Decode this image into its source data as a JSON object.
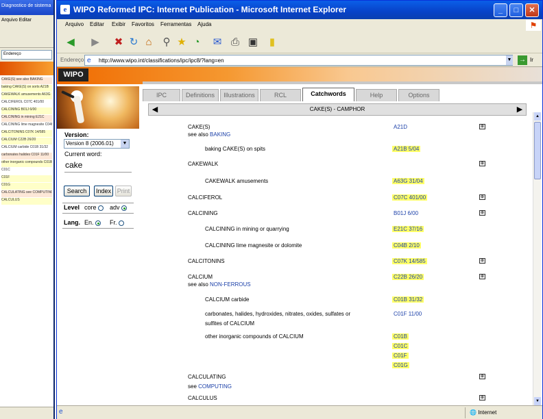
{
  "background_window": {
    "title": "Diagnostico de sistema",
    "menu": "Arquivo Editar",
    "address": "Endereço",
    "rows": [
      "CAKE(S) see also BAKING",
      "baking CAKE(S) on sorts A21B",
      "CAKEWALK amusements A63G",
      "CALCIFEROL C07C 401/00",
      "CALCINING B01J 6/00",
      "CALCINING in mining E21C",
      "CALCINING lime magnesite C04B",
      "CALCITONINS C07K 14/585",
      "CALCIUM C22B 26/20",
      "CALCIUM carbide C01B 31/32",
      "carbonates halides C01F 11/00",
      "other inorganic compounds C01B",
      "C01C",
      "C01F",
      "C01G",
      "CALCULATING see COMPUTING",
      "CALCULUS"
    ]
  },
  "window": {
    "title": "WIPO Reformed IPC: Internet Publication - Microsoft Internet Explorer",
    "minimize": "_",
    "maximize": "□",
    "close": "✕"
  },
  "menu": [
    "Arquivo",
    "Editar",
    "Exibir",
    "Favoritos",
    "Ferramentas",
    "Ajuda"
  ],
  "address": {
    "label": "Endereço",
    "url": "http://www.wipo.int/classifications/ipc/ipc8/?lang=en",
    "go": "Ir"
  },
  "page": {
    "logo": "WIPO",
    "version_label": "Version:",
    "version_value": "Version 8 (2006.01)",
    "current_word_label": "Current word:",
    "current_word": "cake",
    "search_btn": "Search",
    "index_btn": "Index",
    "print_btn": "Print",
    "level_label": "Level",
    "level_core": "core",
    "level_adv": "adv",
    "lang_label": "Lang.",
    "lang_en": "En.",
    "lang_fr": "Fr.",
    "tabs": [
      "IPC",
      "Definitions",
      "Illustrations",
      "RCL",
      "Catchwords",
      "Help",
      "Options"
    ],
    "nav_title": "CAKE(S) - CAMPHOR",
    "nav_prev": "◀",
    "nav_next": "▶"
  },
  "entries": [
    {
      "kw": "CAKE(S)",
      "code": "A21D",
      "hl": false,
      "ex": true
    },
    {
      "see": "see also",
      "link": "BAKING"
    },
    {
      "sub": "baking CAKE(S) on spits",
      "code": "A21B 5/04",
      "hl": true
    },
    {
      "kw": "CAKEWALK",
      "ex": true
    },
    {
      "sub": "CAKEWALK amusements",
      "code": "A63G 31/04",
      "hl": true
    },
    {
      "kw": "CALCIFEROL",
      "code": "C07C 401/00",
      "hl": true,
      "ex": true
    },
    {
      "kw": "CALCINING",
      "code": "B01J 6/00",
      "hl": false,
      "ex": true
    },
    {
      "sub": "CALCINING in mining or quarrying",
      "code": "E21C 37/16",
      "hl": true
    },
    {
      "sub": "CALCINING lime magnesite or dolomite",
      "code": "C04B 2/10",
      "hl": true
    },
    {
      "kw": "CALCITONINS",
      "code": "C07K 14/585",
      "hl": true,
      "ex": true
    },
    {
      "kw": "CALCIUM",
      "code": "C22B 26/20",
      "hl": true,
      "ex": true
    },
    {
      "see": "see also",
      "link": "NON-FERROUS"
    },
    {
      "sub": "CALCIUM carbide",
      "code": "C01B 31/32",
      "hl": true
    },
    {
      "sub": "carbonates, halides, hydroxides, nitrates, oxides, sulfates or",
      "code": "C01F 11/00",
      "hl": false
    },
    {
      "sub2": "sulfites of CALCIUM"
    },
    {
      "sub": "other inorganic compounds of CALCIUM",
      "code": "C01B",
      "hl": true
    },
    {
      "code": "C01C",
      "hl": true
    },
    {
      "code": "C01F",
      "hl": true
    },
    {
      "code": "C01G",
      "hl": true
    },
    {
      "kw": "CALCULATING",
      "ex": true
    },
    {
      "see": "see",
      "link": "COMPUTING"
    },
    {
      "kw": "CALCULUS",
      "ex": true
    }
  ],
  "status": {
    "zone": "Internet"
  }
}
